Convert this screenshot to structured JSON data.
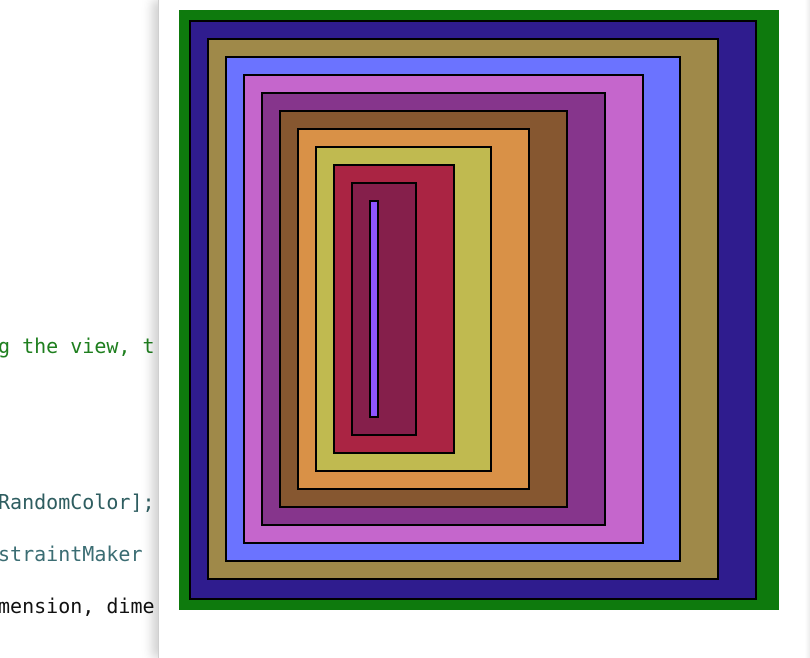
{
  "editor": {
    "lines": [
      {
        "text": "g the view, t",
        "style": "comment"
      },
      {
        "text": "RandomColor];",
        "style": "method"
      },
      {
        "text": "straintMaker ",
        "style": "ident"
      },
      {
        "text": "mension, dime",
        "style": "plain"
      }
    ]
  },
  "simulator": {
    "boxes": [
      {
        "name": "outer-green-box",
        "color": "#0e7a0d"
      },
      {
        "name": "indigo-box",
        "color": "#2f1c8e"
      },
      {
        "name": "olive-box",
        "color": "#9f8949"
      },
      {
        "name": "periwinkle-box",
        "color": "#6b73ff"
      },
      {
        "name": "orchid-box",
        "color": "#c566cc"
      },
      {
        "name": "purple-box",
        "color": "#86358c"
      },
      {
        "name": "brown-box",
        "color": "#865730"
      },
      {
        "name": "orange-box",
        "color": "#d99147"
      },
      {
        "name": "khaki-box",
        "color": "#c0ba50"
      },
      {
        "name": "crimson-box",
        "color": "#aa2443"
      },
      {
        "name": "maroon-box",
        "color": "#851f4b"
      },
      {
        "name": "violet-box",
        "color": "#8f55ff"
      }
    ]
  }
}
